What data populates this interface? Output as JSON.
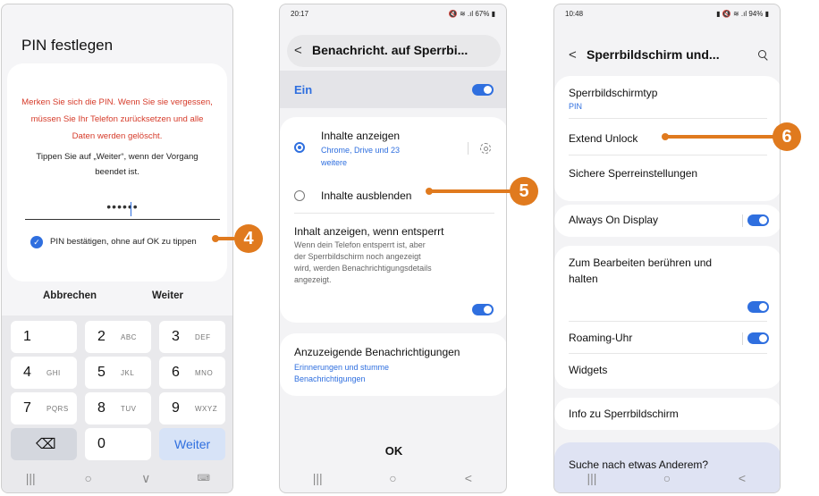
{
  "phone1": {
    "title": "PIN festlegen",
    "warning": "Merken Sie sich die PIN. Wenn Sie sie vergessen, müssen Sie Ihr Telefon zurücksetzen und alle Daten werden gelöscht.",
    "hint": "Tippen Sie auf „Weiter“, wenn der Vorgang beendet ist.",
    "pin_value": "••••••",
    "checkbox_label": "PIN bestätigen, ohne auf OK zu tippen",
    "cancel_label": "Abbrechen",
    "next_label": "Weiter",
    "keys": [
      {
        "digit": "1",
        "letters": ""
      },
      {
        "digit": "2",
        "letters": "ABC"
      },
      {
        "digit": "3",
        "letters": "DEF"
      },
      {
        "digit": "4",
        "letters": "GHI"
      },
      {
        "digit": "5",
        "letters": "JKL"
      },
      {
        "digit": "6",
        "letters": "MNO"
      },
      {
        "digit": "7",
        "letters": "PQRS"
      },
      {
        "digit": "8",
        "letters": "TUV"
      },
      {
        "digit": "9",
        "letters": "WXYZ"
      }
    ],
    "backspace_icon": "⌫",
    "zero": "0",
    "weiter_key": "Weiter",
    "nav": [
      "|||",
      "○",
      "∨",
      "⌨"
    ]
  },
  "phone2": {
    "status_time": "20:17",
    "status_right": "🔇 ≋ .ıl 67% ▮",
    "title": "Benachricht. auf Sperrbi...",
    "toggle_label": "Ein",
    "show_content": "Inhalte anzeigen",
    "show_content_sub_1": "Chrome, Drive und 23",
    "show_content_sub_2": "weitere",
    "hide_content": "Inhalte ausblenden",
    "unlocked_title": "Inhalt anzeigen, wenn entsperrt",
    "unlocked_desc": [
      "Wenn dein Telefon entsperrt ist, aber",
      "der Sperrbildschirm noch angezeigt",
      "wird, werden Benachrichtigungsdetails",
      "angezeigt."
    ],
    "notif_title": "Anzuzeigende Benachrichtigungen",
    "notif_sub_1": "Erinnerungen und stumme",
    "notif_sub_2": "Benachrichtigungen",
    "ok": "OK",
    "nav": [
      "|||",
      "○",
      "<"
    ]
  },
  "phone3": {
    "status_time": "10:48",
    "status_right": "▮ 🔇 ≋ .ıl 94% ▮",
    "title": "Sperrbildschirm und...",
    "lock_type": "Sperrbildschirmtyp",
    "lock_type_value": "PIN",
    "extend_unlock": "Extend Unlock",
    "secure_lock": "Sichere Sperreinstellungen",
    "always_on": "Always On Display",
    "touch_hold_1": "Zum Bearbeiten berühren und",
    "touch_hold_2": "halten",
    "roaming": "Roaming-Uhr",
    "widgets": "Widgets",
    "info": "Info zu Sperrbildschirm",
    "search_more": "Suche nach etwas Anderem?",
    "nav": [
      "|||",
      "○",
      "<"
    ]
  },
  "callouts": [
    "4",
    "5",
    "6"
  ],
  "accent_color": "#e07a1e",
  "toggle_color": "#2f6fdf",
  "warning_color": "#d63b2a"
}
